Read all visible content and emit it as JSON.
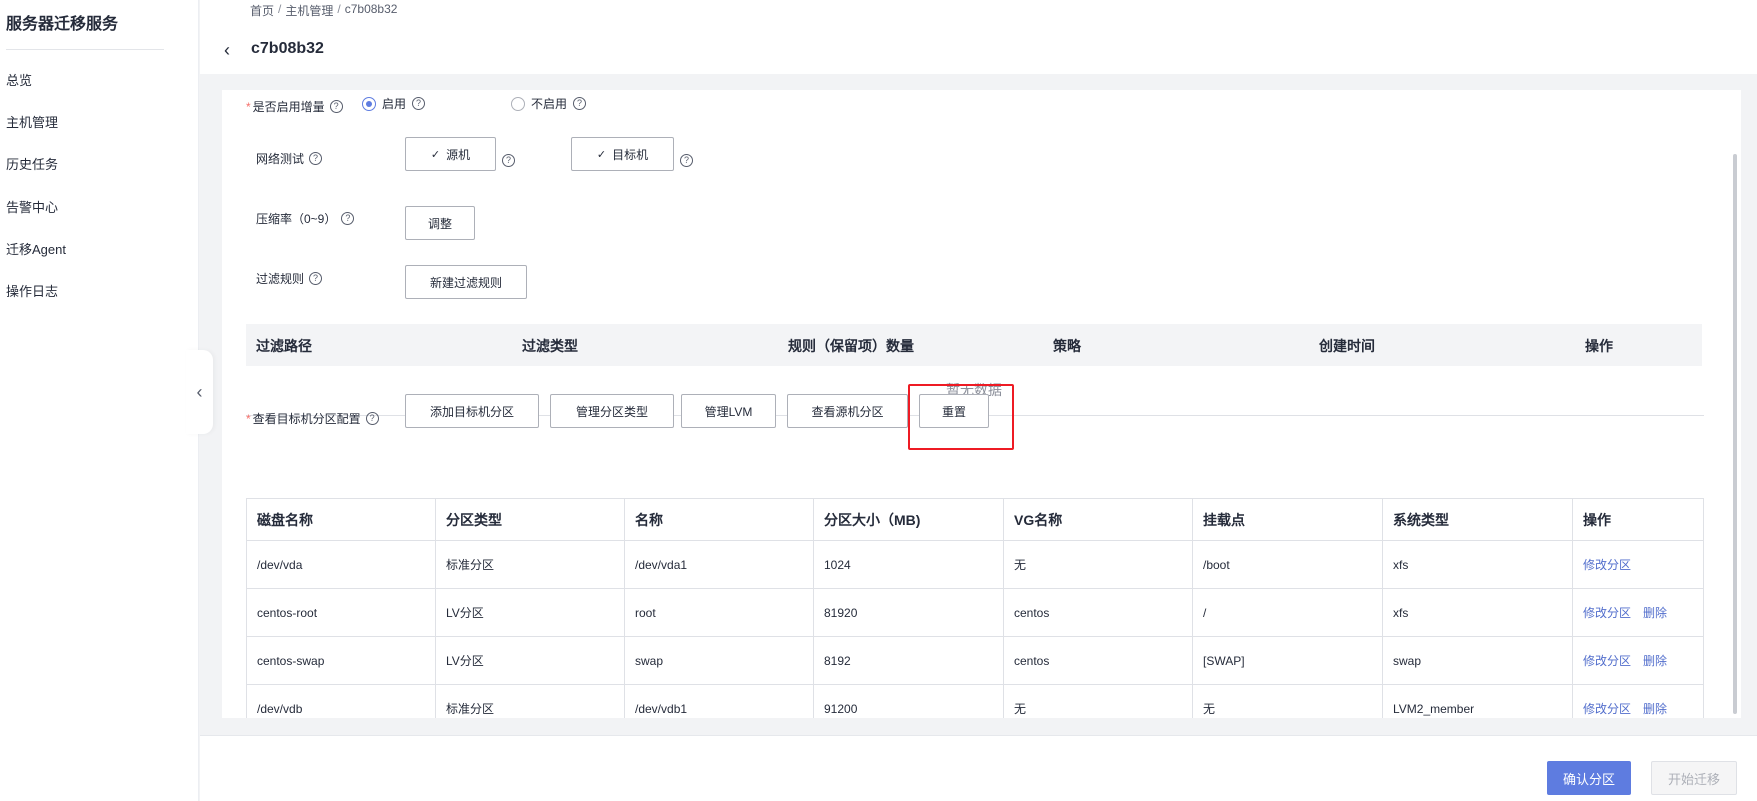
{
  "sidebar": {
    "title": "服务器迁移服务",
    "items": [
      {
        "label": "总览"
      },
      {
        "label": "主机管理"
      },
      {
        "label": "历史任务"
      },
      {
        "label": "告警中心"
      },
      {
        "label": "迁移Agent"
      },
      {
        "label": "操作日志"
      }
    ]
  },
  "breadcrumb": [
    "首页",
    "主机管理",
    "c7b08b32"
  ],
  "page_title": "c7b08b32",
  "form": {
    "incremental": {
      "label": "是否启用增量",
      "options": [
        {
          "label": "启用",
          "selected": true
        },
        {
          "label": "不启用",
          "selected": false
        }
      ]
    },
    "network_test": {
      "label": "网络测试",
      "source_btn": "源机",
      "target_btn": "目标机"
    },
    "compression": {
      "label": "压缩率（0~9）",
      "button": "调整"
    },
    "filter_rules": {
      "label": "过滤规则",
      "button": "新建过滤规则",
      "columns": [
        "过滤路径",
        "过滤类型",
        "规则（保留项）数量",
        "策略",
        "创建时间",
        "操作"
      ],
      "empty_text": "暂无数据"
    },
    "partition_config": {
      "label": "查看目标机分区配置",
      "buttons": {
        "add": "添加目标机分区",
        "manage_type": "管理分区类型",
        "manage_lvm": "管理LVM",
        "view_source": "查看源机分区",
        "reset": "重置"
      }
    }
  },
  "partition_table": {
    "columns": [
      "磁盘名称",
      "分区类型",
      "名称",
      "分区大小（MB)",
      "VG名称",
      "挂载点",
      "系统类型",
      "操作"
    ],
    "rows": [
      {
        "disk": "/dev/vda",
        "type": "标准分区",
        "name": "/dev/vda1",
        "size": "1024",
        "vg": "无",
        "mount": "/boot",
        "fs": "xfs",
        "op_edit": "修改分区",
        "op_delete": ""
      },
      {
        "disk": "centos-root",
        "type": "LV分区",
        "name": "root",
        "size": "81920",
        "vg": "centos",
        "mount": "/",
        "fs": "xfs",
        "op_edit": "修改分区",
        "op_delete": "删除"
      },
      {
        "disk": "centos-swap",
        "type": "LV分区",
        "name": "swap",
        "size": "8192",
        "vg": "centos",
        "mount": "[SWAP]",
        "fs": "swap",
        "op_edit": "修改分区",
        "op_delete": "删除"
      },
      {
        "disk": "/dev/vdb",
        "type": "标准分区",
        "name": "/dev/vdb1",
        "size": "91200",
        "vg": "无",
        "mount": "无",
        "fs": "LVM2_member",
        "op_edit": "修改分区",
        "op_delete": "删除"
      }
    ]
  },
  "footer": {
    "confirm": "确认分区",
    "start": "开始迁移"
  },
  "colors": {
    "primary": "#5e7ce0",
    "link": "#526ecc",
    "required": "#f66f6a",
    "highlight": "#ee1b24"
  }
}
